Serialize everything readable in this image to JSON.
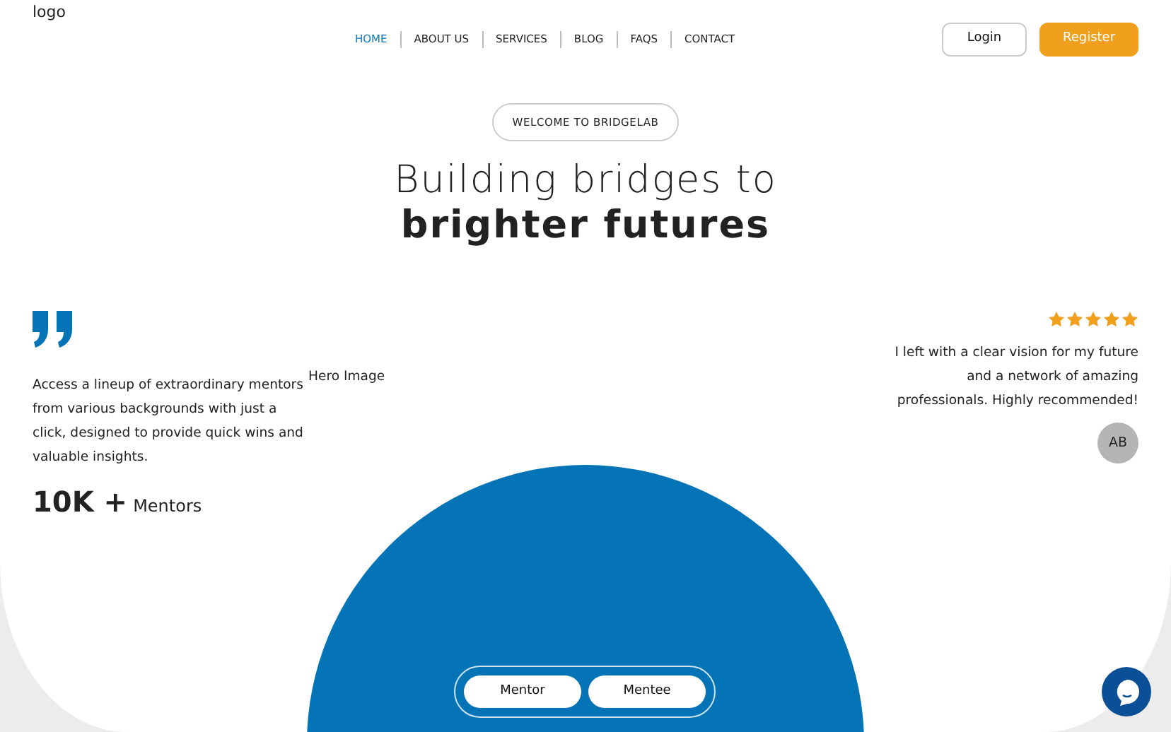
{
  "logo": "logo",
  "nav": [
    {
      "label": "HOME",
      "selected": true
    },
    {
      "label": "ABOUT US",
      "selected": false
    },
    {
      "label": "SERVICES",
      "selected": false
    },
    {
      "label": "BLOG",
      "selected": false
    },
    {
      "label": "FAQS",
      "selected": false
    },
    {
      "label": "CONTACT",
      "selected": false
    }
  ],
  "auth_buttons": {
    "login": "Login",
    "register": "Register"
  },
  "hero": {
    "badge": "WELCOME TO BRIDGELAB",
    "title_line_1": "Building bridges to",
    "title_line_2": "brighter futures"
  },
  "intro": {
    "text": "Access a lineup of extraordinary mentors from various backgrounds with just a click, designed to provide quick wins and valuable insights.",
    "hero_image_alt": "Hero Image",
    "stat_value": "10K +",
    "stat_label": "Mentors"
  },
  "testimonial": {
    "stars": 5,
    "text": "I left with a clear vision for my future and a network of amazing professionals. Highly recommended!",
    "initials": "AB"
  },
  "role_toggle": [
    "Mentor",
    "Mentee"
  ]
}
